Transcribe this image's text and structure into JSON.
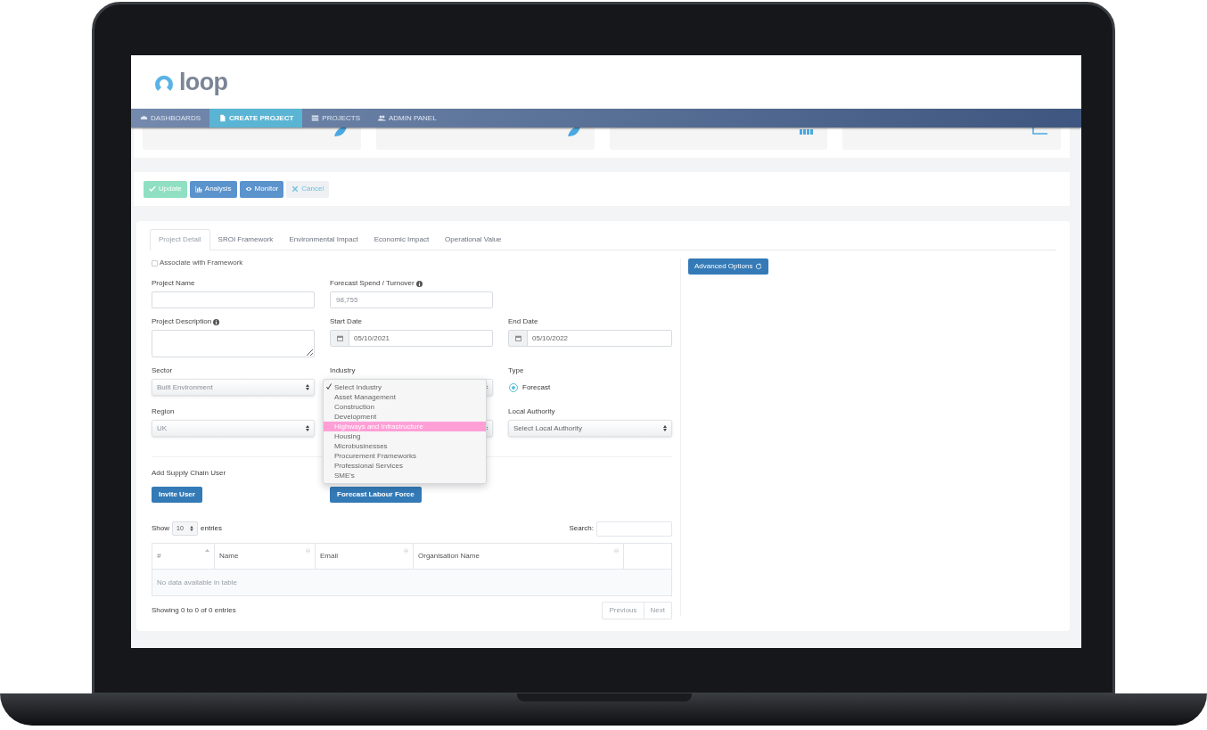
{
  "logo": {
    "text": "loop"
  },
  "nav": [
    {
      "label": "DASHBOARDS",
      "selected": false
    },
    {
      "label": "CREATE PROJECT",
      "selected": true
    },
    {
      "label": "PROJECTS",
      "selected": false
    },
    {
      "label": "ADMIN PANEL",
      "selected": false
    }
  ],
  "actions": [
    {
      "label": "Update",
      "kind": "success"
    },
    {
      "label": "Analysis",
      "kind": "primary"
    },
    {
      "label": "Monitor",
      "kind": "primary"
    },
    {
      "label": "Cancel",
      "kind": "default"
    }
  ],
  "tabs": [
    {
      "label": "Project Detail",
      "selected": true
    },
    {
      "label": "SROI Framework",
      "selected": false
    },
    {
      "label": "Environmental Impact",
      "selected": false
    },
    {
      "label": "Economic Impact",
      "selected": false
    },
    {
      "label": "Operational Value",
      "selected": false
    }
  ],
  "framework": {
    "label": "Associate with Framework",
    "checked": false
  },
  "project_name": {
    "label": "Project Name"
  },
  "forecast_spend": {
    "label": "Forecast Spend / Turnover",
    "placeholder": "98,755"
  },
  "project_description": {
    "label": "Project Description"
  },
  "start_date": {
    "label": "Start Date",
    "value": "05/10/2021"
  },
  "end_date": {
    "label": "End Date",
    "value": "05/10/2022"
  },
  "sector": {
    "label": "Sector",
    "value": "Built Environment"
  },
  "industry": {
    "label": "Industry",
    "options": [
      {
        "label": "Select Industry",
        "checked": true,
        "selected": false
      },
      {
        "label": "Asset Management",
        "checked": false,
        "selected": false
      },
      {
        "label": "Construction",
        "checked": false,
        "selected": false
      },
      {
        "label": "Development",
        "checked": false,
        "selected": false
      },
      {
        "label": "Highways and Infrastructure",
        "checked": false,
        "selected": true
      },
      {
        "label": "Housing",
        "checked": false,
        "selected": false
      },
      {
        "label": "Microbusinesses",
        "checked": false,
        "selected": false
      },
      {
        "label": "Procurement Frameworks",
        "checked": false,
        "selected": false
      },
      {
        "label": "Professional Services",
        "checked": false,
        "selected": false
      },
      {
        "label": "SME's",
        "checked": false,
        "selected": false
      }
    ]
  },
  "type": {
    "label": "Type",
    "option": {
      "label": "Forecast",
      "selected": true
    }
  },
  "region": {
    "label": "Region",
    "value": "UK"
  },
  "local_authority": {
    "label": "Local Authority",
    "value": "Select Local Authority"
  },
  "supply_chain": {
    "label": "Add Supply Chain User",
    "invite_button": "Invite User",
    "labour_button": "Forecast Labour Force"
  },
  "table": {
    "show_label": "Show",
    "page_size": "10",
    "entries_label": "entries",
    "search_label": "Search:",
    "columns": [
      "#",
      "Name",
      "Email",
      "Organisation Name"
    ],
    "empty_message": "No data available in table",
    "info": "Showing 0 to 0 of 0 entries",
    "pagination": [
      "Previous",
      "Next"
    ]
  },
  "advanced_button": "Advanced Options"
}
